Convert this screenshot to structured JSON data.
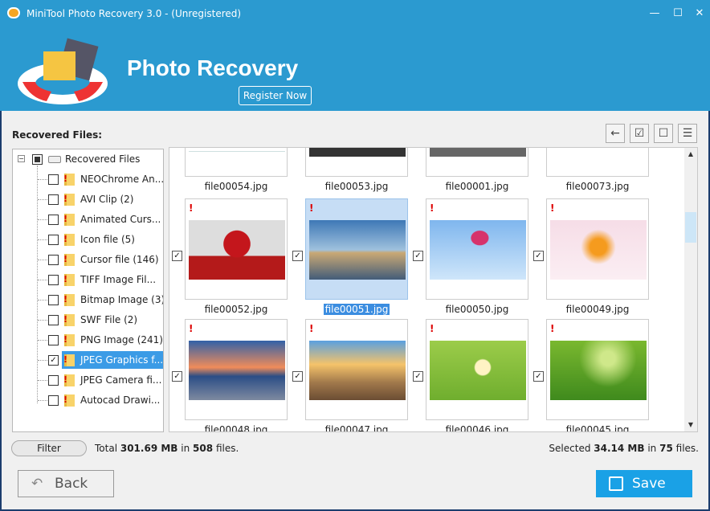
{
  "window": {
    "title": "MiniTool Photo Recovery 3.0 - (Unregistered)",
    "minimize": "—",
    "maximize": "☐",
    "close": "✕"
  },
  "header": {
    "title": "Photo Recovery",
    "register_label": "Register Now"
  },
  "sidebar": {
    "label": "Recovered Files:",
    "root": "Recovered Files",
    "items": [
      {
        "label": "NEOChrome An...",
        "checked": false
      },
      {
        "label": "AVI Clip (2)",
        "checked": false
      },
      {
        "label": "Animated Curs...",
        "checked": false
      },
      {
        "label": "Icon file (5)",
        "checked": false
      },
      {
        "label": "Cursor file (146)",
        "checked": false
      },
      {
        "label": "TIFF Image Fil...",
        "checked": false
      },
      {
        "label": "Bitmap Image (3)",
        "checked": false
      },
      {
        "label": "SWF File (2)",
        "checked": false
      },
      {
        "label": "PNG Image (241)",
        "checked": false
      },
      {
        "label": "JPEG Graphics f...",
        "checked": true,
        "selected": true
      },
      {
        "label": "JPEG Camera fi...",
        "checked": false
      },
      {
        "label": "Autocad Drawi...",
        "checked": false
      }
    ]
  },
  "toolbar": {
    "back": "back-icon",
    "check_all": "check-all-icon",
    "uncheck_all": "uncheck-all-icon",
    "view": "list-view-icon"
  },
  "files": [
    {
      "name": "file00054.jpg"
    },
    {
      "name": "file00053.jpg"
    },
    {
      "name": "file00001.jpg"
    },
    {
      "name": "file00073.jpg"
    },
    {
      "name": "file00052.jpg",
      "checked": true
    },
    {
      "name": "file00051.jpg",
      "checked": true,
      "selected": true
    },
    {
      "name": "file00050.jpg",
      "checked": true
    },
    {
      "name": "file00049.jpg",
      "checked": true
    },
    {
      "name": "file00048.jpg",
      "checked": true
    },
    {
      "name": "file00047.jpg",
      "checked": true
    },
    {
      "name": "file00046.jpg",
      "checked": true
    },
    {
      "name": "file00045.jpg",
      "checked": true
    }
  ],
  "footer": {
    "filter_label": "Filter",
    "total_prefix": "Total",
    "total_size": "301.69 MB",
    "in": "in",
    "total_count": "508",
    "files_suffix": "files.",
    "selected_prefix": "Selected",
    "selected_size": "34.14 MB",
    "selected_count": "75"
  },
  "buttons": {
    "back": "Back",
    "save": "Save"
  },
  "colors": {
    "accent": "#2b9ad0",
    "save": "#1aa1e6",
    "selection": "#3b9be6"
  }
}
